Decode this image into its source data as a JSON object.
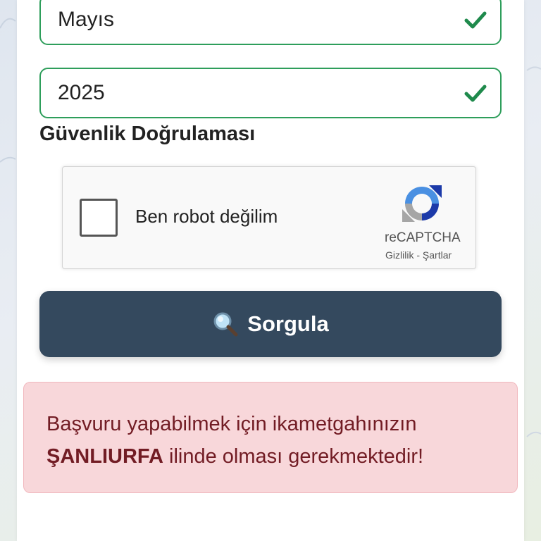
{
  "form": {
    "month_value": "Mayıs",
    "year_value": "2025",
    "security_title": "Güvenlik Doğrulaması"
  },
  "recaptcha": {
    "label": "Ben robot değilim",
    "brand": "reCAPTCHA",
    "privacy": "Gizlilik",
    "separator": " - ",
    "terms": "Şartlar"
  },
  "query_button": {
    "icon": "🔍",
    "label": "Sorgula"
  },
  "alert": {
    "line1": "Başvuru yapabilmek için ikametgahınızın",
    "province": "ŞANLIURFA",
    "line2_rest": " ilinde olması gerekmektedir!"
  },
  "colors": {
    "valid_green": "#2e9e5b",
    "button_bg": "#34495e",
    "alert_bg": "#f8d7da",
    "alert_text": "#721c24"
  }
}
